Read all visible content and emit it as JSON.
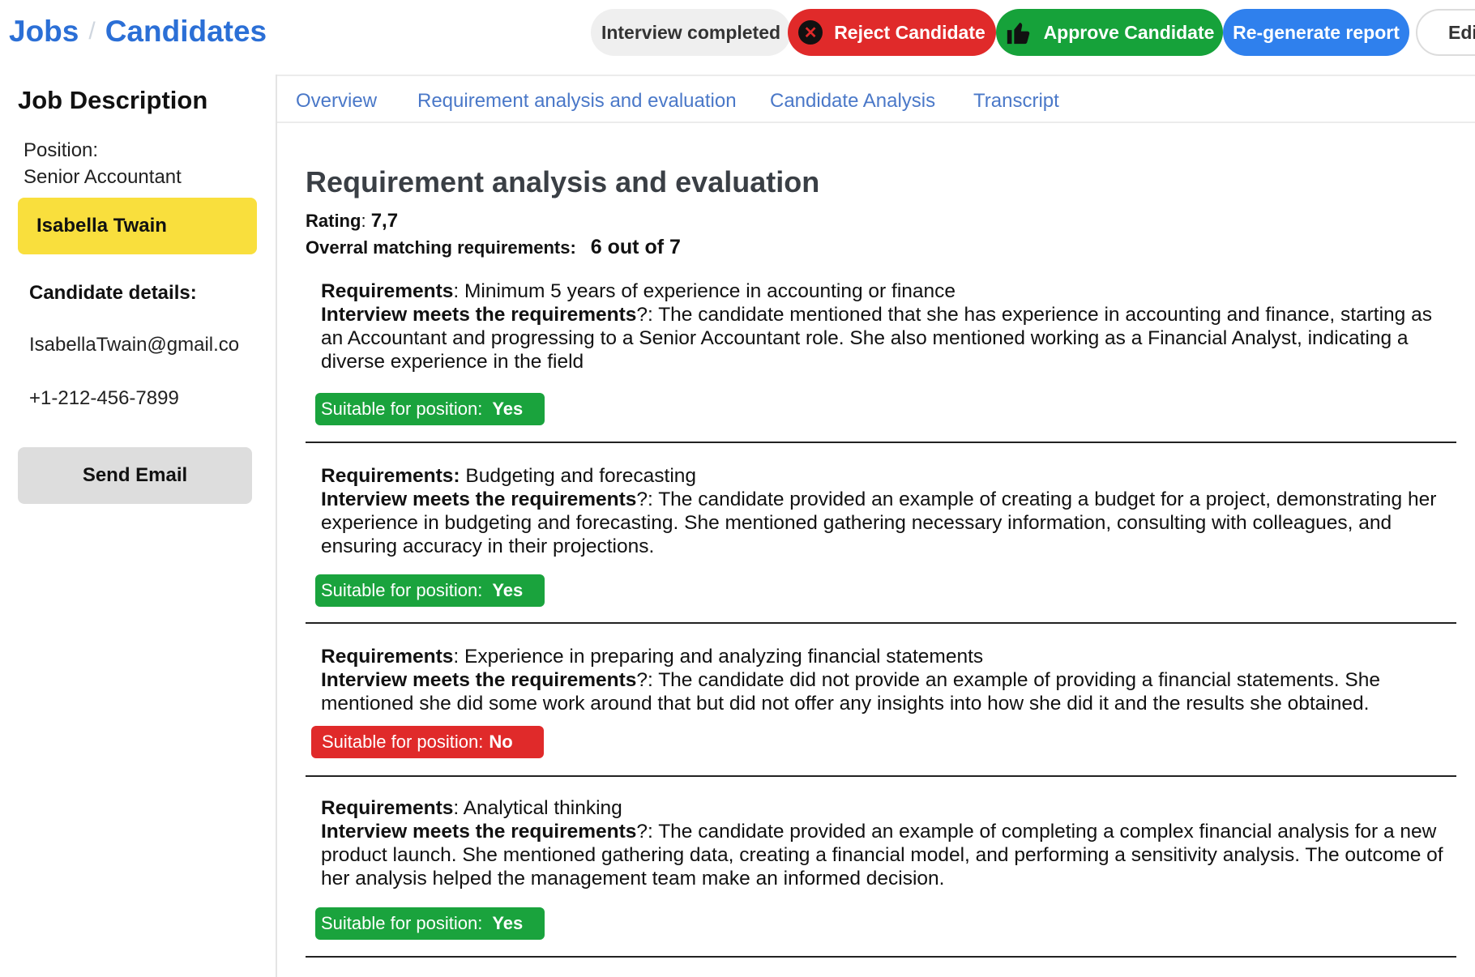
{
  "header": {
    "breadcrumb": [
      "Jobs",
      "Candidates"
    ],
    "status": "Interview completed",
    "reject_label": "Reject Candidate",
    "approve_label": "Approve Candidate",
    "regenerate_label": "Re-generate report",
    "edit_label": "Edit",
    "colors": {
      "reject": "#e02a2a",
      "approve": "#16a23a",
      "regenerate": "#2f80ed",
      "candidate_highlight": "#f9df3d",
      "link": "#2b6fd6"
    }
  },
  "sidebar": {
    "title": "Job Description",
    "position_label": "Position:",
    "position_value": "Senior Accountant",
    "candidate_name": "Isabella Twain",
    "details_title": "Candidate details:",
    "email": "IsabellaTwain@gmail.co",
    "phone": "+1-212-456-7899",
    "send_email_label": "Send Email"
  },
  "tabs": [
    "Overview",
    "Requirement analysis and evaluation",
    "Candidate Analysis",
    "Transcript"
  ],
  "main": {
    "title": "Requirement analysis and evaluation",
    "rating_label": "Rating",
    "rating_value": "7,7",
    "overall_label": "Overral matching requirements:",
    "overall_value": "6 out of 7",
    "requirements_label": "Requirements",
    "meets_label": "Interview meets the requirements",
    "suitable_label": "Suitable for position:",
    "items": [
      {
        "requirement": "Minimum 5 years of experience in accounting or finance",
        "evaluation": "The candidate mentioned that she has experience in accounting and finance, starting as an Accountant and progressing to a Senior Accountant role. She also mentioned working as a Financial Analyst, indicating a diverse experience in the field",
        "suitable": "Yes"
      },
      {
        "requirement": "Budgeting and forecasting",
        "evaluation": "The candidate provided an example of creating a budget for a project, demonstrating her experience in budgeting and forecasting. She mentioned gathering necessary information, consulting with colleagues, and ensuring accuracy in their projections.",
        "suitable": "Yes"
      },
      {
        "requirement": "Experience in preparing and analyzing financial statements",
        "evaluation": "The candidate did not provide an example of providing a financial statements. She mentioned she did some work around that but did not offer any insights into how she did it and the results she obtained.",
        "suitable": "No"
      },
      {
        "requirement": "Analytical thinking",
        "evaluation": "The candidate provided an example of completing a complex financial analysis for a new product launch. She mentioned gathering data, creating a financial model, and performing a sensitivity analysis. The outcome of her analysis helped the management team make an informed decision.",
        "suitable": "Yes"
      }
    ]
  }
}
